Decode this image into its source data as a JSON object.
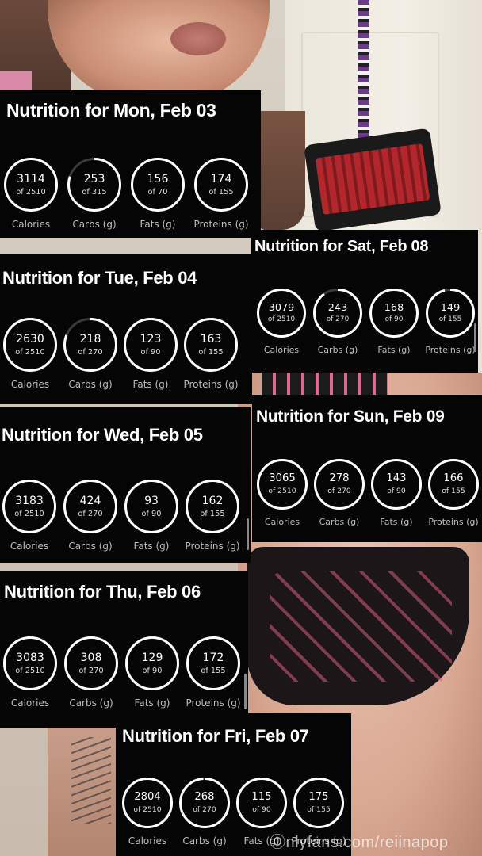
{
  "watermark": "Ⓞnlyfans.com/reiinapop",
  "panels": [
    {
      "title": "Nutrition for Mon, Feb 03",
      "metrics": [
        {
          "value": "3114",
          "target": "of 2510",
          "label": "Calories",
          "progress": 1.0
        },
        {
          "value": "253",
          "target": "of 315",
          "label": "Carbs (g)",
          "progress": 0.8
        },
        {
          "value": "156",
          "target": "of 70",
          "label": "Fats (g)",
          "progress": 1.0
        },
        {
          "value": "174",
          "target": "of 155",
          "label": "Proteins (g)",
          "progress": 1.0
        }
      ]
    },
    {
      "title": "Nutrition for Tue, Feb 04",
      "metrics": [
        {
          "value": "2630",
          "target": "of 2510",
          "label": "Calories",
          "progress": 1.0
        },
        {
          "value": "218",
          "target": "of 270",
          "label": "Carbs (g)",
          "progress": 0.81
        },
        {
          "value": "123",
          "target": "of 90",
          "label": "Fats (g)",
          "progress": 1.0
        },
        {
          "value": "163",
          "target": "of 155",
          "label": "Proteins (g)",
          "progress": 1.0
        }
      ]
    },
    {
      "title": "Nutrition for Wed, Feb 05",
      "metrics": [
        {
          "value": "3183",
          "target": "of 2510",
          "label": "Calories",
          "progress": 1.0
        },
        {
          "value": "424",
          "target": "of 270",
          "label": "Carbs (g)",
          "progress": 1.0
        },
        {
          "value": "93",
          "target": "of 90",
          "label": "Fats (g)",
          "progress": 1.0
        },
        {
          "value": "162",
          "target": "of 155",
          "label": "Proteins (g)",
          "progress": 1.0
        }
      ]
    },
    {
      "title": "Nutrition for Thu, Feb 06",
      "metrics": [
        {
          "value": "3083",
          "target": "of 2510",
          "label": "Calories",
          "progress": 1.0
        },
        {
          "value": "308",
          "target": "of 270",
          "label": "Carbs (g)",
          "progress": 1.0
        },
        {
          "value": "129",
          "target": "of 90",
          "label": "Fats (g)",
          "progress": 1.0
        },
        {
          "value": "172",
          "target": "of 155",
          "label": "Proteins (g)",
          "progress": 1.0
        }
      ]
    },
    {
      "title": "Nutrition for Fri, Feb 07",
      "metrics": [
        {
          "value": "2804",
          "target": "of 2510",
          "label": "Calories",
          "progress": 1.0
        },
        {
          "value": "268",
          "target": "of 270",
          "label": "Carbs (g)",
          "progress": 0.99
        },
        {
          "value": "115",
          "target": "of 90",
          "label": "Fats (g)",
          "progress": 1.0
        },
        {
          "value": "175",
          "target": "of 155",
          "label": "Proteins (g)",
          "progress": 1.0
        }
      ]
    },
    {
      "title": "Nutrition for Sat, Feb 08",
      "metrics": [
        {
          "value": "3079",
          "target": "of 2510",
          "label": "Calories",
          "progress": 1.0
        },
        {
          "value": "243",
          "target": "of 270",
          "label": "Carbs (g)",
          "progress": 0.9
        },
        {
          "value": "168",
          "target": "of 90",
          "label": "Fats (g)",
          "progress": 1.0
        },
        {
          "value": "149",
          "target": "of 155",
          "label": "Proteins (g)",
          "progress": 0.96
        }
      ]
    },
    {
      "title": "Nutrition for Sun, Feb 09",
      "metrics": [
        {
          "value": "3065",
          "target": "of 2510",
          "label": "Calories",
          "progress": 1.0
        },
        {
          "value": "278",
          "target": "of 270",
          "label": "Carbs (g)",
          "progress": 1.0
        },
        {
          "value": "143",
          "target": "of 90",
          "label": "Fats (g)",
          "progress": 1.0
        },
        {
          "value": "166",
          "target": "of 155",
          "label": "Proteins (g)",
          "progress": 1.0
        }
      ]
    }
  ],
  "colors": {
    "panel_bg": "#050505",
    "ring": "#ffffff",
    "ring_track": "#3a3a3a",
    "label": "#bdbdbd"
  }
}
